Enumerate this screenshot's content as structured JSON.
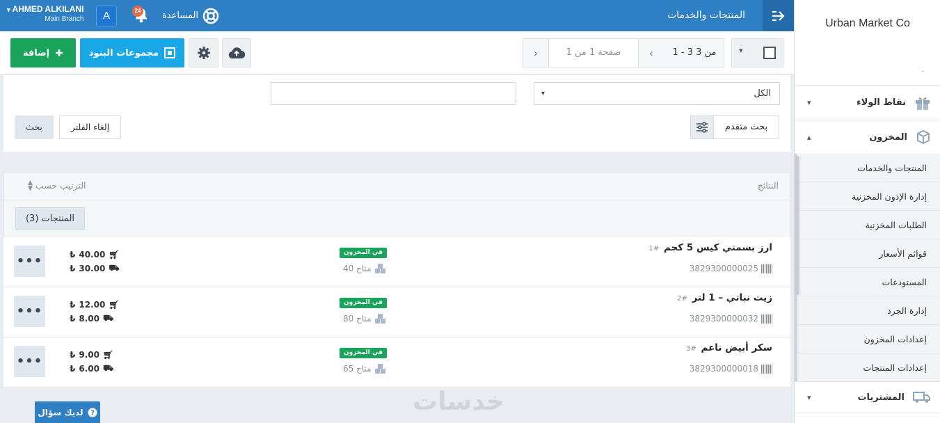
{
  "sidebar": {
    "brand": "Urban Market Co",
    "loyalty": "نقاط الولاء",
    "inventory": "المخزون",
    "purchases": "المشتريات",
    "items": [
      {
        "label": "المنتجات والخدمات"
      },
      {
        "label": "إدارة الإذون المخزنية"
      },
      {
        "label": "الطلبات المخزنية"
      },
      {
        "label": "قوائم الأسعار"
      },
      {
        "label": "المستودعات"
      },
      {
        "label": "إدارة الجرد"
      },
      {
        "label": "إعدادات المخزون"
      },
      {
        "label": "إعدادات المنتجات"
      }
    ]
  },
  "topbar": {
    "page_title": "المنتجات والخدمات",
    "help": "المساعدة",
    "notif_count": "24",
    "user_name": "AHMED ALKILANI",
    "branch": "Main Branch",
    "avatar_letter": "A"
  },
  "toolbar": {
    "add": "إضافة",
    "groups": "مجموعات البنود",
    "page_info": "صفحة 1 من 1",
    "range": "1 - 3 من 3"
  },
  "filters": {
    "all": "الكل",
    "advanced": "بحث متقدم",
    "clear": "إلغاء الفلتر",
    "search": "بحث"
  },
  "results": {
    "title": "النتائج",
    "sort": "الترتيب حسب",
    "group_label": "المنتجات (3)"
  },
  "products": [
    {
      "name": "ارز بسمتي كيس 5 كجم",
      "num": "#1",
      "sku": "3829300000025",
      "stock_label": "في المخزون",
      "available": "40 متاح",
      "sell_price": "40.00",
      "buy_price": "30.00"
    },
    {
      "name": "زيت نباتي – 1 لتر",
      "num": "#2",
      "sku": "3829300000032",
      "stock_label": "في المخزون",
      "available": "80 متاح",
      "sell_price": "12.00",
      "buy_price": "8.00"
    },
    {
      "name": "سكر أبيض ناعم",
      "num": "#3",
      "sku": "3829300000018",
      "stock_label": "في المخزون",
      "available": "65 متاح",
      "sell_price": "9.00",
      "buy_price": "6.00"
    }
  ],
  "footer": {
    "ask": "لديك سؤال",
    "watermark": "خدسات"
  },
  "colors": {
    "primary": "#2f7fc4",
    "success": "#1aa35b",
    "info": "#1aa7e8"
  }
}
